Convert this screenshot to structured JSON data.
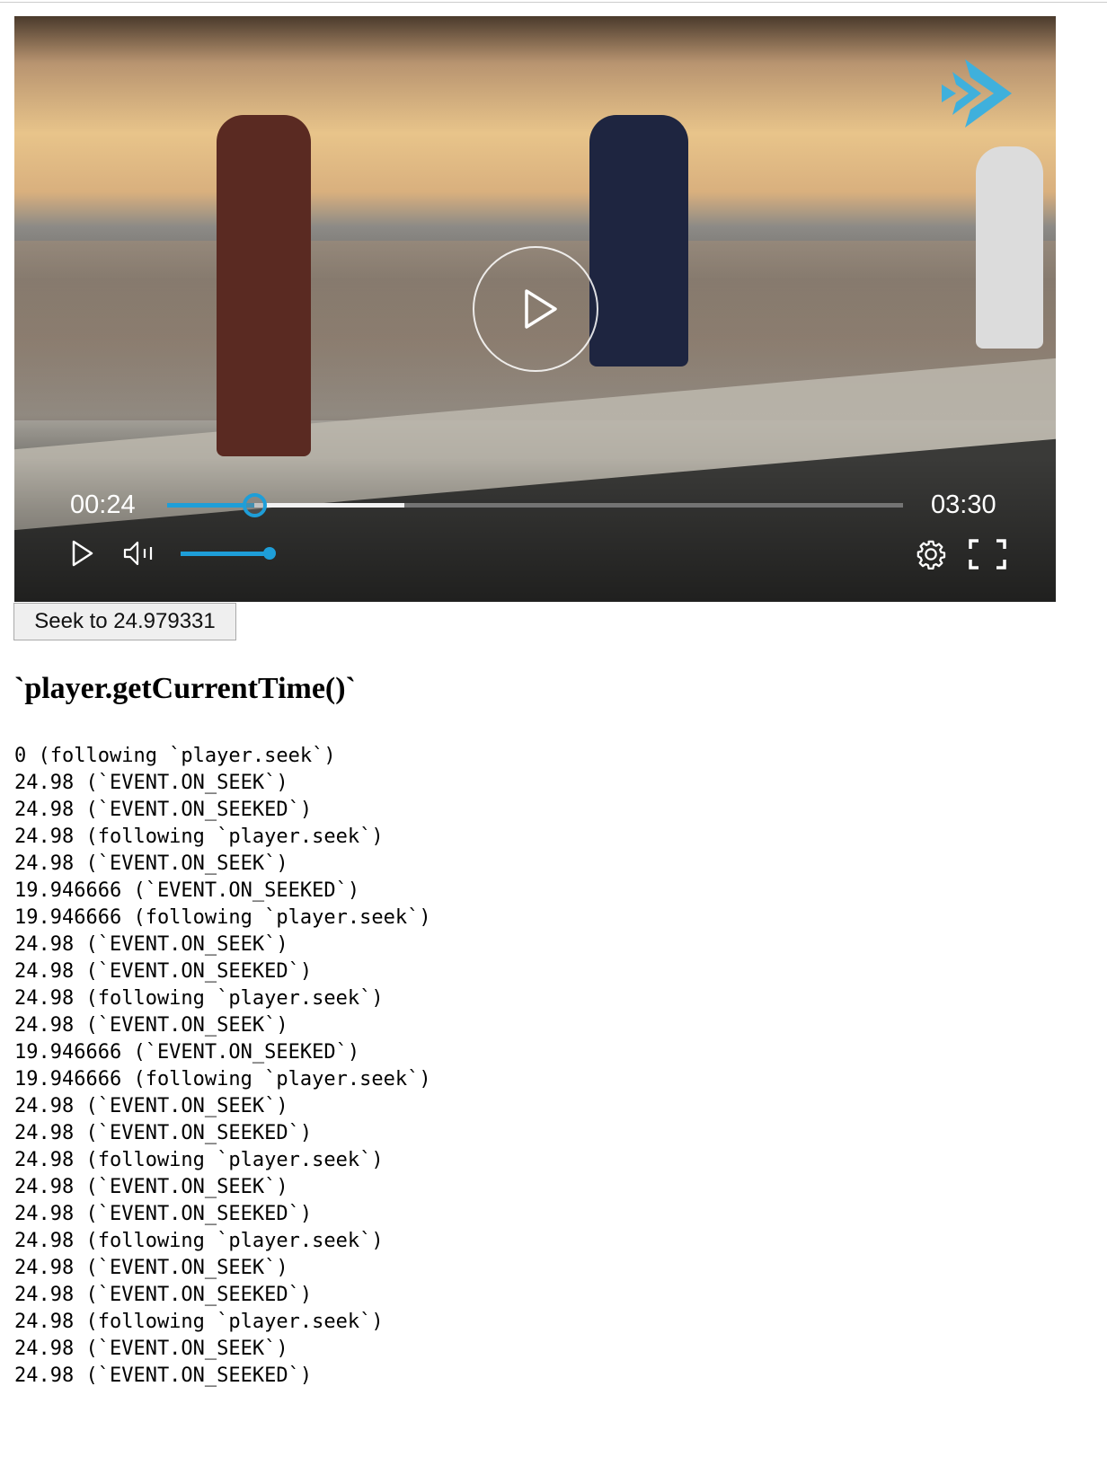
{
  "player": {
    "current_time": "00:24",
    "duration": "03:30",
    "progress_fraction": 0.119,
    "buffered_fraction": 0.322,
    "volume_fraction": 1.0,
    "accent_color": "#1e9ed8"
  },
  "seek_button": {
    "label": "Seek to 24.979331"
  },
  "heading": "`player.getCurrentTime()`",
  "log": [
    "0 (following `player.seek`)",
    "24.98 (`EVENT.ON_SEEK`)",
    "24.98 (`EVENT.ON_SEEKED`)",
    "24.98 (following `player.seek`)",
    "24.98 (`EVENT.ON_SEEK`)",
    "19.946666 (`EVENT.ON_SEEKED`)",
    "19.946666 (following `player.seek`)",
    "24.98 (`EVENT.ON_SEEK`)",
    "24.98 (`EVENT.ON_SEEKED`)",
    "24.98 (following `player.seek`)",
    "24.98 (`EVENT.ON_SEEK`)",
    "19.946666 (`EVENT.ON_SEEKED`)",
    "19.946666 (following `player.seek`)",
    "24.98 (`EVENT.ON_SEEK`)",
    "24.98 (`EVENT.ON_SEEKED`)",
    "24.98 (following `player.seek`)",
    "24.98 (`EVENT.ON_SEEK`)",
    "24.98 (`EVENT.ON_SEEKED`)",
    "24.98 (following `player.seek`)",
    "24.98 (`EVENT.ON_SEEK`)",
    "24.98 (`EVENT.ON_SEEKED`)",
    "24.98 (following `player.seek`)",
    "24.98 (`EVENT.ON_SEEK`)",
    "24.98 (`EVENT.ON_SEEKED`)"
  ]
}
